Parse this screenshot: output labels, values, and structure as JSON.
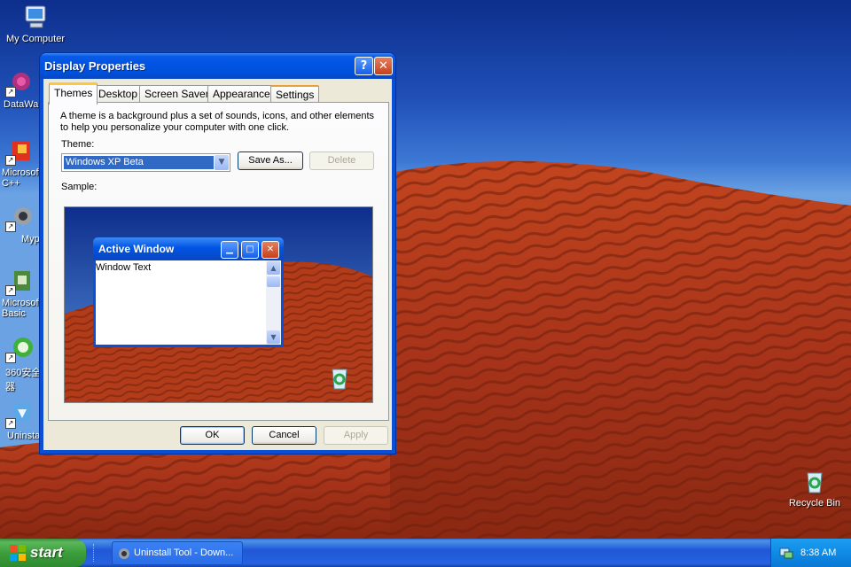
{
  "desktop": {
    "icons": [
      {
        "label": "My Computer",
        "icon": "my-computer-icon"
      },
      {
        "label": "DataWa",
        "icon": "program-shortcut-icon"
      },
      {
        "label": "Microsoft C++",
        "icon": "program-shortcut-icon"
      },
      {
        "label": "Myp",
        "icon": "program-shortcut-icon"
      },
      {
        "label": "Microsoft Basic",
        "icon": "program-shortcut-icon"
      },
      {
        "label": "360安全 器",
        "icon": "program-shortcut-icon"
      },
      {
        "label": "Uninsta",
        "icon": "program-shortcut-icon"
      },
      {
        "label": "Recycle Bin",
        "icon": "recycle-bin-icon"
      }
    ]
  },
  "window": {
    "title": "Display Properties",
    "help_glyph": "?",
    "close_glyph": "✕",
    "tabs": [
      {
        "label": "Themes",
        "active": true
      },
      {
        "label": "Desktop",
        "active": false
      },
      {
        "label": "Screen Saver",
        "active": false
      },
      {
        "label": "Appearance",
        "active": false
      },
      {
        "label": "Settings",
        "active": false
      }
    ],
    "description": "A theme is a background plus a set of sounds, icons, and other elements to help you personalize your computer with one click.",
    "theme_label": "Theme:",
    "theme_value": "Windows XP Beta",
    "save_as_label": "Save As...",
    "delete_label": "Delete",
    "sample_label": "Sample:",
    "sample": {
      "window_title": "Active Window",
      "window_text": "Window Text"
    },
    "ok_label": "OK",
    "cancel_label": "Cancel",
    "apply_label": "Apply"
  },
  "taskbar": {
    "start_label": "start",
    "task_label": "Uninstall Tool - Down...",
    "clock": "8:38 AM"
  },
  "colors": {
    "titlebar": "#0054e3",
    "dialog_face": "#ece9d8",
    "selection": "#316ac5",
    "taskbar": "#2157d7",
    "start_button": "#3c9e3c"
  }
}
